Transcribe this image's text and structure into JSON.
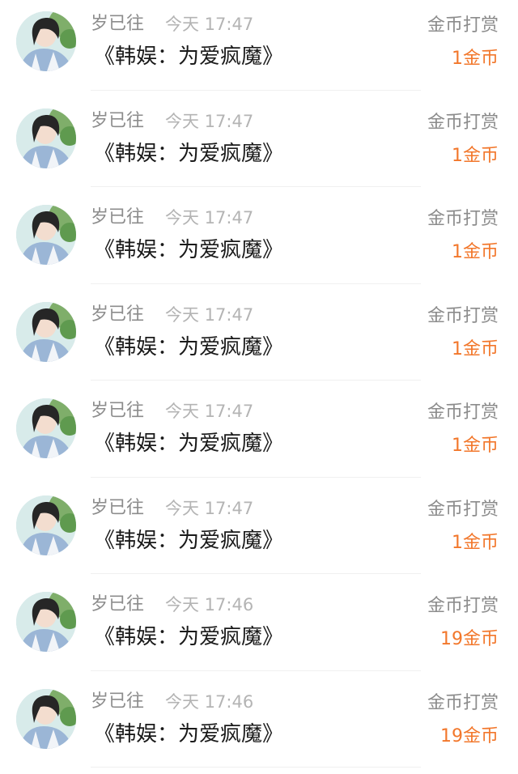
{
  "records": [
    {
      "name": "岁已往",
      "time": "今天 17:47",
      "title": "《韩娱：为爱疯魔》",
      "type": "金币打赏",
      "amount": "1金币"
    },
    {
      "name": "岁已往",
      "time": "今天 17:47",
      "title": "《韩娱：为爱疯魔》",
      "type": "金币打赏",
      "amount": "1金币"
    },
    {
      "name": "岁已往",
      "time": "今天 17:47",
      "title": "《韩娱：为爱疯魔》",
      "type": "金币打赏",
      "amount": "1金币"
    },
    {
      "name": "岁已往",
      "time": "今天 17:47",
      "title": "《韩娱：为爱疯魔》",
      "type": "金币打赏",
      "amount": "1金币"
    },
    {
      "name": "岁已往",
      "time": "今天 17:47",
      "title": "《韩娱：为爱疯魔》",
      "type": "金币打赏",
      "amount": "1金币"
    },
    {
      "name": "岁已往",
      "time": "今天 17:47",
      "title": "《韩娱：为爱疯魔》",
      "type": "金币打赏",
      "amount": "1金币"
    },
    {
      "name": "岁已往",
      "time": "今天 17:46",
      "title": "《韩娱：为爱疯魔》",
      "type": "金币打赏",
      "amount": "19金币"
    },
    {
      "name": "岁已往",
      "time": "今天 17:46",
      "title": "《韩娱：为爱疯魔》",
      "type": "金币打赏",
      "amount": "19金币"
    }
  ],
  "colors": {
    "amount": "#f2772b",
    "name": "#8c8c8c",
    "time": "#b4b4b4",
    "title": "#1a1a1a"
  },
  "icons": {
    "avatar": "user-avatar-photo"
  }
}
